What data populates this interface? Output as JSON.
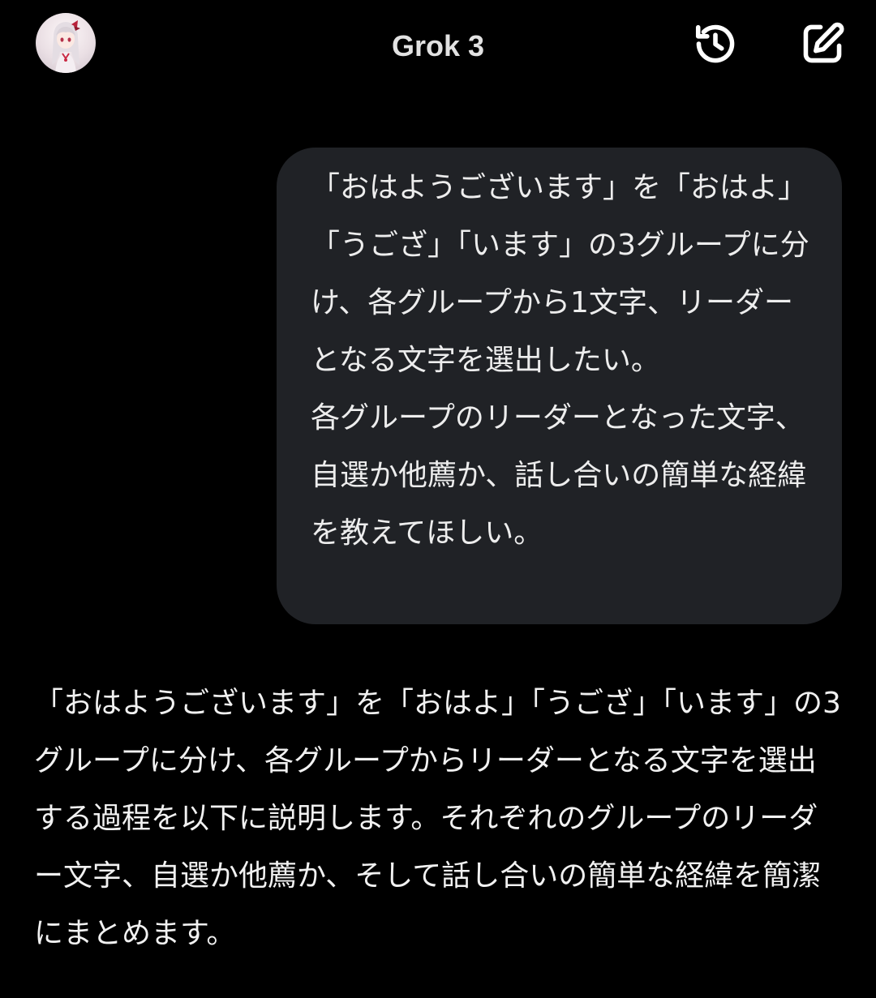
{
  "header": {
    "title": "Grok 3",
    "avatar_icon": "anime-avatar",
    "history_icon": "history-icon",
    "compose_icon": "edit-icon"
  },
  "conversation": {
    "user_message": "「おはようございます」を「おはよ」「うござ」「います」の3グループに分け、各グループから1文字、リーダーとなる文字を選出したい。\n各グループのリーダーとなった文字、自選か他薦か、話し合いの簡単な経緯を教えてほしい。",
    "assistant_message": "「おはようございます」を「おはよ」「うござ」「います」の3グループに分け、各グループからリーダーとなる文字を選出する過程を以下に説明します。それぞれのグループのリーダー文字、自選か他薦か、そして話し合いの簡単な経緯を簡潔にまとめます。"
  },
  "colors": {
    "background": "#000000",
    "user_bubble": "#202226",
    "text": "#f1f1f1"
  }
}
